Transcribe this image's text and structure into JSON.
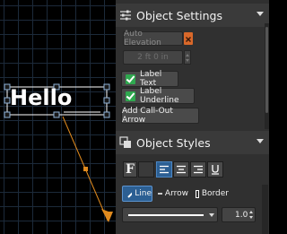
{
  "canvas": {
    "text": "Hello"
  },
  "object_settings": {
    "title": "Object Settings",
    "auto_elevation_label": "Auto Elevation",
    "elevation_value": "2 ft 0 in",
    "label_text_label": "Label Text",
    "label_text_checked": true,
    "label_underline_label": "Label Underline",
    "label_underline_checked": true,
    "callout_arrow_label": "Add Call-Out Arrow"
  },
  "object_styles": {
    "title": "Object Styles",
    "font_button_label": "F",
    "tabs": [
      {
        "label": "Line",
        "active": true
      },
      {
        "label": "Arrow",
        "active": false
      },
      {
        "label": "Border",
        "active": false
      }
    ],
    "line_width": "1.0"
  },
  "colors": {
    "accent": "#2c5f93",
    "check": "#2fa84f",
    "arrow": "#e08a1e",
    "remove": "#d9682a"
  }
}
